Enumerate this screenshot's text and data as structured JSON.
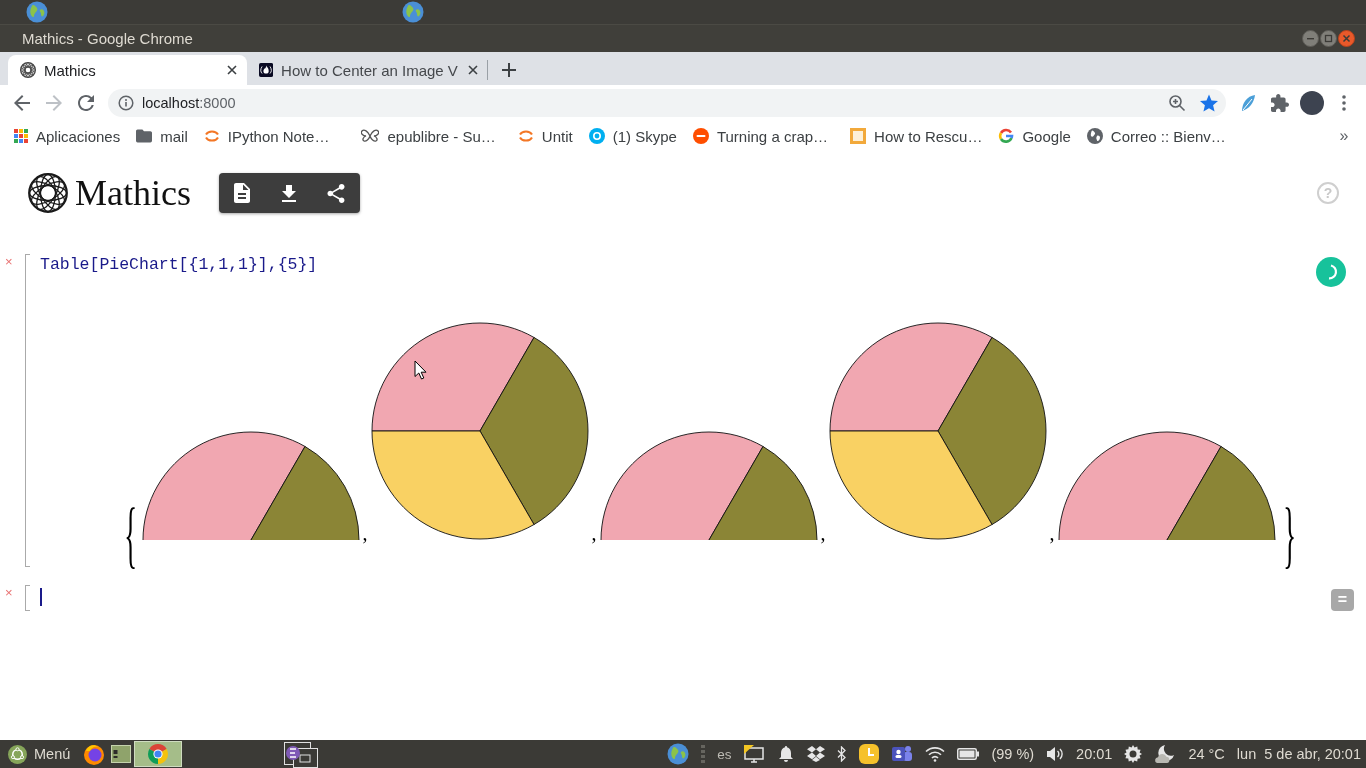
{
  "window": {
    "title": "Mathics - Google Chrome"
  },
  "tabs": [
    {
      "kind": "sphere",
      "title": "Mathics",
      "selected": true
    },
    {
      "kind": "flame",
      "title": "How to Center an Image V",
      "selected": false
    }
  ],
  "address_bar": {
    "host": "localhost",
    "port": ":8000"
  },
  "bookmarks": {
    "items": [
      {
        "kind": "apps",
        "label": "Aplicaciones"
      },
      {
        "kind": "folder",
        "label": "mail"
      },
      {
        "kind": "arcs",
        "label": "IPython Note…"
      },
      {
        "kind": "butterfly",
        "label": "epublibre - Su…"
      },
      {
        "kind": "arcs",
        "label": "Untit"
      },
      {
        "kind": "skype",
        "label": "(1) Skype"
      },
      {
        "kind": "ars",
        "label": "Turning a crap…"
      },
      {
        "kind": "tile",
        "label": "How to Rescu…"
      },
      {
        "kind": "google",
        "label": "Google"
      },
      {
        "kind": "globe",
        "label": "Correo :: Bienv…"
      }
    ],
    "overflow": "»"
  },
  "app": {
    "name": "Mathics",
    "help": "?"
  },
  "notebook": {
    "cells": [
      {
        "delete": "×",
        "input": "Table[PieChart[{1,1,1}],{5}]",
        "focused": false,
        "running": true,
        "output": {
          "open": "{",
          "items": [
            {
              "kind": "half",
              "separator": ","
            },
            {
              "kind": "full",
              "separator": ","
            },
            {
              "kind": "half",
              "separator": ","
            },
            {
              "kind": "full",
              "separator": ","
            },
            {
              "kind": "half"
            }
          ],
          "close": "}"
        }
      },
      {
        "delete": "×",
        "focused": true,
        "evaluate": "="
      }
    ]
  },
  "taskbar": {
    "menu": "Menú",
    "tasks": [
      {
        "kind": "chrome",
        "selected": true
      },
      {
        "kind": "emacs",
        "selected": false
      }
    ],
    "tray": {
      "layout": "es",
      "battery": "(99 %)",
      "time": "20:01",
      "temperature": "24 °C",
      "date": "lun  5 de abr, 20:01"
    }
  }
}
